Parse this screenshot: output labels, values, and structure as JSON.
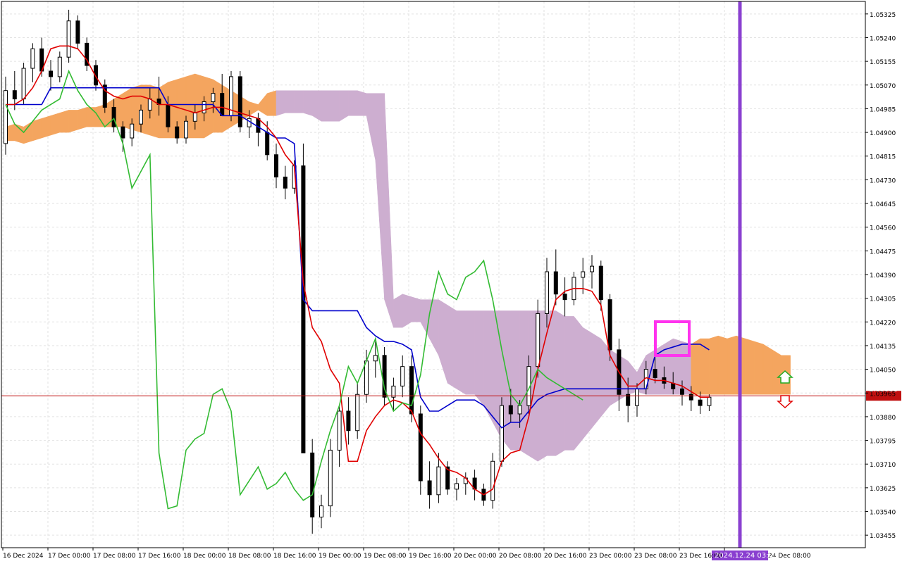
{
  "chart_data": {
    "type": "candlestick",
    "title": "",
    "ylim": [
      1.0341,
      1.0537
    ],
    "y_ticks": [
      "1.05325",
      "1.05240",
      "1.05155",
      "1.05070",
      "1.04985",
      "1.04900",
      "1.04815",
      "1.04730",
      "1.04645",
      "1.04560",
      "1.04475",
      "1.04390",
      "1.04305",
      "1.04220",
      "1.04135",
      "1.04050",
      "1.03965",
      "1.03880",
      "1.03795",
      "1.03710",
      "1.03625",
      "1.03540",
      "1.03455"
    ],
    "x_ticks": [
      "16 Dec 2024",
      "17 Dec 00:00",
      "17 Dec 08:00",
      "17 Dec 16:00",
      "18 Dec 00:00",
      "18 Dec 08:00",
      "18 Dec 16:00",
      "19 Dec 00:00",
      "19 Dec 08:00",
      "19 Dec 16:00",
      "20 Dec 00:00",
      "20 Dec 08:00",
      "20 Dec 16:00",
      "23 Dec 00:00",
      "23 Dec 08:00",
      "23 Dec 16:00",
      "24 Dec 08:00"
    ],
    "current_price": "1.03955",
    "cursor_time_label": "2024.12.24 03:00",
    "colors": {
      "background": "#ffffff",
      "grid": "#e2e2e2",
      "tenkan": "#e00000",
      "kijun": "#0000cc",
      "chikou": "#33bb33",
      "kumo_bull": "#f4a55f",
      "kumo_bear": "#cdaed0",
      "current_price_line": "#c01010",
      "vertical_marker": "#8a3fd0",
      "highlight_box": "#ff33ee",
      "arrow_up": "#22aa22",
      "arrow_down": "#e00000",
      "candle_bull": "#ffffff",
      "candle_bear": "#000000",
      "candle_bull_accent": "#2060a0"
    },
    "candles": [
      [
        1.0486,
        1.051,
        1.0482,
        1.0505
      ],
      [
        1.0505,
        1.0512,
        1.0498,
        1.0502
      ],
      [
        1.0502,
        1.0515,
        1.05,
        1.0513
      ],
      [
        1.0513,
        1.0522,
        1.0508,
        1.052
      ],
      [
        1.052,
        1.0524,
        1.051,
        1.0512
      ],
      [
        1.0512,
        1.0516,
        1.0505,
        1.051
      ],
      [
        1.051,
        1.0519,
        1.0508,
        1.0517
      ],
      [
        1.0517,
        1.0534,
        1.0515,
        1.053
      ],
      [
        1.053,
        1.0532,
        1.052,
        1.0522
      ],
      [
        1.0522,
        1.0524,
        1.0512,
        1.0514
      ],
      [
        1.0514,
        1.0516,
        1.0505,
        1.0507
      ],
      [
        1.0507,
        1.0509,
        1.0497,
        1.0499
      ],
      [
        1.0499,
        1.0502,
        1.049,
        1.0492
      ],
      [
        1.0492,
        1.0494,
        1.0483,
        1.0488
      ],
      [
        1.0488,
        1.0495,
        1.0485,
        1.0493
      ],
      [
        1.0493,
        1.05,
        1.049,
        1.0498
      ],
      [
        1.0498,
        1.0506,
        1.0495,
        1.0502
      ],
      [
        1.0502,
        1.051,
        1.0496,
        1.05
      ],
      [
        1.05,
        1.0503,
        1.049,
        1.0492
      ],
      [
        1.0492,
        1.0494,
        1.0486,
        1.0488
      ],
      [
        1.0488,
        1.0496,
        1.0486,
        1.0494
      ],
      [
        1.0494,
        1.05,
        1.0491,
        1.0497
      ],
      [
        1.0497,
        1.0503,
        1.0494,
        1.0501
      ],
      [
        1.0501,
        1.0506,
        1.0497,
        1.0504
      ],
      [
        1.0504,
        1.0511,
        1.05,
        1.0496
      ],
      [
        1.0496,
        1.0512,
        1.0494,
        1.051
      ],
      [
        1.051,
        1.0512,
        1.049,
        1.0492
      ],
      [
        1.0492,
        1.0498,
        1.0488,
        1.0495
      ],
      [
        1.0495,
        1.0497,
        1.0485,
        1.049
      ],
      [
        1.049,
        1.0494,
        1.048,
        1.0482
      ],
      [
        1.0482,
        1.0486,
        1.047,
        1.0474
      ],
      [
        1.0474,
        1.0478,
        1.0466,
        1.047
      ],
      [
        1.047,
        1.048,
        1.0468,
        1.0478
      ],
      [
        1.0478,
        1.0486,
        1.047,
        1.0375
      ],
      [
        1.0375,
        1.038,
        1.0346,
        1.0352
      ],
      [
        1.0352,
        1.036,
        1.0348,
        1.0356
      ],
      [
        1.0356,
        1.038,
        1.0352,
        1.0376
      ],
      [
        1.0376,
        1.0392,
        1.037,
        1.039
      ],
      [
        1.039,
        1.0395,
        1.0378,
        1.0383
      ],
      [
        1.0383,
        1.04,
        1.038,
        1.0396
      ],
      [
        1.0396,
        1.0412,
        1.0393,
        1.0408
      ],
      [
        1.0408,
        1.0415,
        1.0402,
        1.041
      ],
      [
        1.041,
        1.0413,
        1.0392,
        1.0395
      ],
      [
        1.0395,
        1.0402,
        1.039,
        1.0399
      ],
      [
        1.0399,
        1.041,
        1.0395,
        1.0406
      ],
      [
        1.0406,
        1.041,
        1.0386,
        1.0389
      ],
      [
        1.0389,
        1.0392,
        1.036,
        1.0365
      ],
      [
        1.0365,
        1.0372,
        1.0355,
        1.036
      ],
      [
        1.036,
        1.0375,
        1.0357,
        1.037
      ],
      [
        1.037,
        1.0372,
        1.036,
        1.0362
      ],
      [
        1.0362,
        1.0366,
        1.0358,
        1.0364
      ],
      [
        1.0364,
        1.0368,
        1.036,
        1.0366
      ],
      [
        1.0366,
        1.0369,
        1.0358,
        1.0362
      ],
      [
        1.0362,
        1.0364,
        1.0356,
        1.0358
      ],
      [
        1.0358,
        1.0375,
        1.0355,
        1.0372
      ],
      [
        1.0372,
        1.0395,
        1.037,
        1.0392
      ],
      [
        1.0392,
        1.0398,
        1.0386,
        1.0389
      ],
      [
        1.0389,
        1.0394,
        1.0384,
        1.0392
      ],
      [
        1.0392,
        1.041,
        1.0389,
        1.0406
      ],
      [
        1.0406,
        1.043,
        1.0402,
        1.0425
      ],
      [
        1.0425,
        1.0445,
        1.042,
        1.044
      ],
      [
        1.044,
        1.0448,
        1.0428,
        1.0432
      ],
      [
        1.0432,
        1.0438,
        1.0424,
        1.043
      ],
      [
        1.043,
        1.044,
        1.0428,
        1.0438
      ],
      [
        1.0438,
        1.0445,
        1.0432,
        1.044
      ],
      [
        1.044,
        1.0446,
        1.0434,
        1.0442
      ],
      [
        1.0442,
        1.0444,
        1.0426,
        1.043
      ],
      [
        1.043,
        1.0432,
        1.0408,
        1.0412
      ],
      [
        1.0412,
        1.0416,
        1.039,
        1.0396
      ],
      [
        1.0396,
        1.0402,
        1.0386,
        1.0392
      ],
      [
        1.0392,
        1.04,
        1.0388,
        1.0398
      ],
      [
        1.0398,
        1.0408,
        1.0396,
        1.0405
      ],
      [
        1.0405,
        1.0412,
        1.04,
        1.0402
      ],
      [
        1.0402,
        1.0406,
        1.0398,
        1.04
      ],
      [
        1.04,
        1.0404,
        1.0396,
        1.0398
      ],
      [
        1.0398,
        1.0401,
        1.0392,
        1.0396
      ],
      [
        1.0396,
        1.0399,
        1.039,
        1.0394
      ],
      [
        1.0394,
        1.0397,
        1.0389,
        1.0392
      ],
      [
        1.0392,
        1.0396,
        1.039,
        1.0395
      ]
    ],
    "tenkan_sen": [
      1.05,
      1.05,
      1.0502,
      1.0506,
      1.0512,
      1.052,
      1.0521,
      1.0521,
      1.052,
      1.0516,
      1.051,
      1.0505,
      1.0503,
      1.0502,
      1.0503,
      1.0503,
      1.0502,
      1.05,
      1.05,
      1.0499,
      1.0498,
      1.0497,
      1.0498,
      1.0499,
      1.0499,
      1.0498,
      1.0497,
      1.0496,
      1.0495,
      1.0492,
      1.0488,
      1.0482,
      1.0478,
      1.0436,
      1.042,
      1.0415,
      1.0405,
      1.04,
      1.0372,
      1.0372,
      1.0383,
      1.0388,
      1.0392,
      1.0394,
      1.0393,
      1.039,
      1.0382,
      1.0378,
      1.0373,
      1.0369,
      1.0368,
      1.0366,
      1.0362,
      1.036,
      1.0362,
      1.0372,
      1.0375,
      1.0376,
      1.0388,
      1.0405,
      1.0418,
      1.043,
      1.0433,
      1.0434,
      1.0434,
      1.0433,
      1.0428,
      1.041,
      1.0404,
      1.0399,
      1.0399,
      1.0402,
      1.0401,
      1.0401,
      1.04,
      1.0399,
      1.0397,
      1.0395,
      1.0395
    ],
    "kijun_sen": [
      1.05,
      1.05,
      1.05,
      1.05,
      1.05,
      1.0506,
      1.0506,
      1.0506,
      1.0506,
      1.0506,
      1.0506,
      1.0506,
      1.0506,
      1.0506,
      1.0506,
      1.0506,
      1.0506,
      1.0506,
      1.05,
      1.05,
      1.05,
      1.05,
      1.05,
      1.05,
      1.0496,
      1.0496,
      1.0496,
      1.0494,
      1.0492,
      1.049,
      1.0488,
      1.0488,
      1.0486,
      1.043,
      1.0426,
      1.0426,
      1.0426,
      1.0426,
      1.0426,
      1.0426,
      1.042,
      1.0417,
      1.0415,
      1.0415,
      1.0414,
      1.0412,
      1.0395,
      1.039,
      1.039,
      1.0392,
      1.0394,
      1.0394,
      1.0394,
      1.0392,
      1.0388,
      1.0384,
      1.0386,
      1.0386,
      1.039,
      1.0394,
      1.0396,
      1.0397,
      1.0398,
      1.0398,
      1.0398,
      1.0398,
      1.0398,
      1.0398,
      1.0398,
      1.0398,
      1.0398,
      1.0398,
      1.041,
      1.0412,
      1.0413,
      1.0414,
      1.0414,
      1.0414,
      1.0412
    ],
    "chikou_span": [
      1.05,
      1.0493,
      1.049,
      1.0494,
      1.0498,
      1.05,
      1.0502,
      1.0512,
      1.0505,
      1.05,
      1.0497,
      1.0492,
      1.0495,
      1.0486,
      1.047,
      1.0476,
      1.0482,
      1.0375,
      1.0355,
      1.0356,
      1.0376,
      1.038,
      1.0382,
      1.0396,
      1.0398,
      1.039,
      1.036,
      1.0365,
      1.037,
      1.0362,
      1.0364,
      1.0368,
      1.0362,
      1.0358,
      1.036,
      1.0372,
      1.0383,
      1.0392,
      1.0406,
      1.04,
      1.0408,
      1.0416,
      1.0398,
      1.039,
      1.0393,
      1.0392,
      1.0403,
      1.0425,
      1.044,
      1.0432,
      1.043,
      1.0438,
      1.044,
      1.0444,
      1.043,
      1.0412,
      1.0396,
      1.0392,
      1.0398,
      1.0405,
      1.0402,
      1.04,
      1.0398,
      1.0396,
      1.0394
    ],
    "kumo": [
      [
        1.0492,
        1.0487
      ],
      [
        1.0493,
        1.0487
      ],
      [
        1.0492,
        1.0486
      ],
      [
        1.0494,
        1.0487
      ],
      [
        1.0495,
        1.0488
      ],
      [
        1.0496,
        1.0489
      ],
      [
        1.0497,
        1.049
      ],
      [
        1.0498,
        1.049
      ],
      [
        1.0498,
        1.0491
      ],
      [
        1.0499,
        1.0492
      ],
      [
        1.0499,
        1.0492
      ],
      [
        1.05,
        1.0492
      ],
      [
        1.0502,
        1.0492
      ],
      [
        1.0504,
        1.0492
      ],
      [
        1.0506,
        1.0491
      ],
      [
        1.0507,
        1.049
      ],
      [
        1.0507,
        1.0489
      ],
      [
        1.0506,
        1.0488
      ],
      [
        1.0508,
        1.0488
      ],
      [
        1.0509,
        1.0488
      ],
      [
        1.051,
        1.0488
      ],
      [
        1.0511,
        1.0488
      ],
      [
        1.051,
        1.0488
      ],
      [
        1.0509,
        1.049
      ],
      [
        1.0507,
        1.049
      ],
      [
        1.0505,
        1.0492
      ],
      [
        1.0503,
        1.0494
      ],
      [
        1.0501,
        1.0496
      ],
      [
        1.05,
        1.0498
      ],
      [
        1.0504,
        1.0496
      ],
      [
        1.0505,
        1.0496
      ],
      [
        1.0505,
        1.0497
      ],
      [
        1.0505,
        1.0497
      ],
      [
        1.0505,
        1.0497
      ],
      [
        1.0505,
        1.0496
      ],
      [
        1.0505,
        1.0494
      ],
      [
        1.0505,
        1.0494
      ],
      [
        1.0505,
        1.0494
      ],
      [
        1.0505,
        1.0496
      ],
      [
        1.0505,
        1.0496
      ],
      [
        1.0504,
        1.0496
      ],
      [
        1.0504,
        1.048
      ],
      [
        1.0504,
        1.043
      ],
      [
        1.043,
        1.042
      ],
      [
        1.0432,
        1.042
      ],
      [
        1.0431,
        1.0422
      ],
      [
        1.043,
        1.0422
      ],
      [
        1.043,
        1.0416
      ],
      [
        1.043,
        1.041
      ],
      [
        1.0428,
        1.04
      ],
      [
        1.0426,
        1.0398
      ],
      [
        1.0426,
        1.0396
      ],
      [
        1.0426,
        1.0396
      ],
      [
        1.0426,
        1.0392
      ],
      [
        1.0426,
        1.0386
      ],
      [
        1.0426,
        1.038
      ],
      [
        1.0426,
        1.0376
      ],
      [
        1.0426,
        1.0376
      ],
      [
        1.0426,
        1.0374
      ],
      [
        1.0426,
        1.0372
      ],
      [
        1.0426,
        1.0374
      ],
      [
        1.0426,
        1.0374
      ],
      [
        1.0424,
        1.0376
      ],
      [
        1.0424,
        1.0376
      ],
      [
        1.042,
        1.038
      ],
      [
        1.0418,
        1.0384
      ],
      [
        1.0416,
        1.0388
      ],
      [
        1.0412,
        1.0392
      ],
      [
        1.041,
        1.0394
      ],
      [
        1.0408,
        1.0396
      ],
      [
        1.0404,
        1.0397
      ],
      [
        1.041,
        1.0396
      ],
      [
        1.0412,
        1.0396
      ],
      [
        1.0414,
        1.0396
      ],
      [
        1.0416,
        1.0396
      ],
      [
        1.0415,
        1.0396
      ],
      [
        1.0414,
        1.0396
      ],
      [
        1.0416,
        1.0396
      ],
      [
        1.0416,
        1.0396
      ],
      [
        1.0417,
        1.0396
      ],
      [
        1.0416,
        1.0396
      ],
      [
        1.0417,
        1.0396
      ],
      [
        1.0416,
        1.0396
      ],
      [
        1.0415,
        1.0396
      ],
      [
        1.0414,
        1.0396
      ],
      [
        1.0412,
        1.0396
      ],
      [
        1.041,
        1.0396
      ],
      [
        1.041,
        1.0396
      ]
    ],
    "grid": true
  }
}
